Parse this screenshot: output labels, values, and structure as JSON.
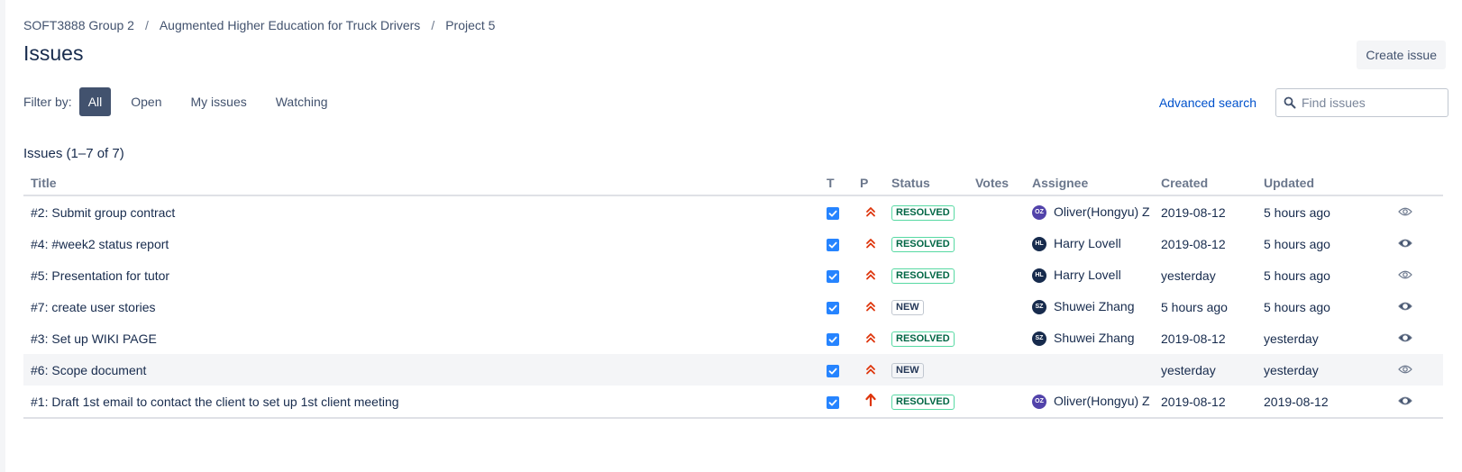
{
  "breadcrumb": {
    "items": [
      "SOFT3888 Group 2",
      "Augmented Higher Education for Truck Drivers",
      "Project 5"
    ],
    "separator": "/"
  },
  "header": {
    "title": "Issues",
    "create_label": "Create issue"
  },
  "filter": {
    "label": "Filter by:",
    "buttons": [
      "All",
      "Open",
      "My issues",
      "Watching"
    ],
    "active": "All"
  },
  "search": {
    "advanced_label": "Advanced search",
    "placeholder": "Find issues"
  },
  "list": {
    "count_label": "Issues (1–7 of 7)",
    "columns": {
      "title": "Title",
      "type": "T",
      "priority": "P",
      "status": "Status",
      "votes": "Votes",
      "assignee": "Assignee",
      "created": "Created",
      "updated": "Updated"
    },
    "rows": [
      {
        "title": "#2: Submit group contract",
        "priority": "major",
        "status": "RESOLVED",
        "votes": "",
        "assignee_initials": "OZ",
        "assignee": "Oliver(Hongyu) Z",
        "created": "2019-08-12",
        "updated": "5 hours ago",
        "watch": "not-watching"
      },
      {
        "title": "#4: #week2 status report",
        "priority": "major",
        "status": "RESOLVED",
        "votes": "",
        "assignee_initials": "HL",
        "assignee": "Harry Lovell",
        "created": "2019-08-12",
        "updated": "5 hours ago",
        "watch": "watching"
      },
      {
        "title": "#5: Presentation for tutor",
        "priority": "major",
        "status": "RESOLVED",
        "votes": "",
        "assignee_initials": "HL",
        "assignee": "Harry Lovell",
        "created": "yesterday",
        "updated": "5 hours ago",
        "watch": "not-watching"
      },
      {
        "title": "#7: create user stories",
        "priority": "major",
        "status": "NEW",
        "votes": "",
        "assignee_initials": "SZ",
        "assignee": "Shuwei Zhang",
        "created": "5 hours ago",
        "updated": "5 hours ago",
        "watch": "watching"
      },
      {
        "title": "#3: Set up WIKI PAGE",
        "priority": "major",
        "status": "RESOLVED",
        "votes": "",
        "assignee_initials": "SZ",
        "assignee": "Shuwei Zhang",
        "created": "2019-08-12",
        "updated": "yesterday",
        "watch": "watching"
      },
      {
        "title": "#6: Scope document",
        "priority": "major",
        "status": "NEW",
        "votes": "",
        "assignee_initials": "",
        "assignee": "",
        "created": "yesterday",
        "updated": "yesterday",
        "watch": "not-watching"
      },
      {
        "title": "#1: Draft 1st email to contact the client to set up 1st client meeting",
        "priority": "critical",
        "status": "RESOLVED",
        "votes": "",
        "assignee_initials": "OZ",
        "assignee": "Oliver(Hongyu) Z",
        "created": "2019-08-12",
        "updated": "2019-08-12",
        "watch": "watching"
      }
    ]
  },
  "colors": {
    "accent": "#0052cc",
    "active_filter": "#42526e",
    "task_icon": "#2684ff",
    "priority": "#de350b",
    "resolved_text": "#006644",
    "resolved_border": "#57d9a3",
    "avatar_oz": "#5243aa",
    "avatar_dark": "#172b4d",
    "highlight_row": "#f4f5f7"
  },
  "icons": {
    "type": "task-checkbox-icon",
    "priority_major": "double-chevron-up-icon",
    "priority_critical": "arrow-up-icon",
    "watch": "eye-icon",
    "search": "search-icon"
  }
}
